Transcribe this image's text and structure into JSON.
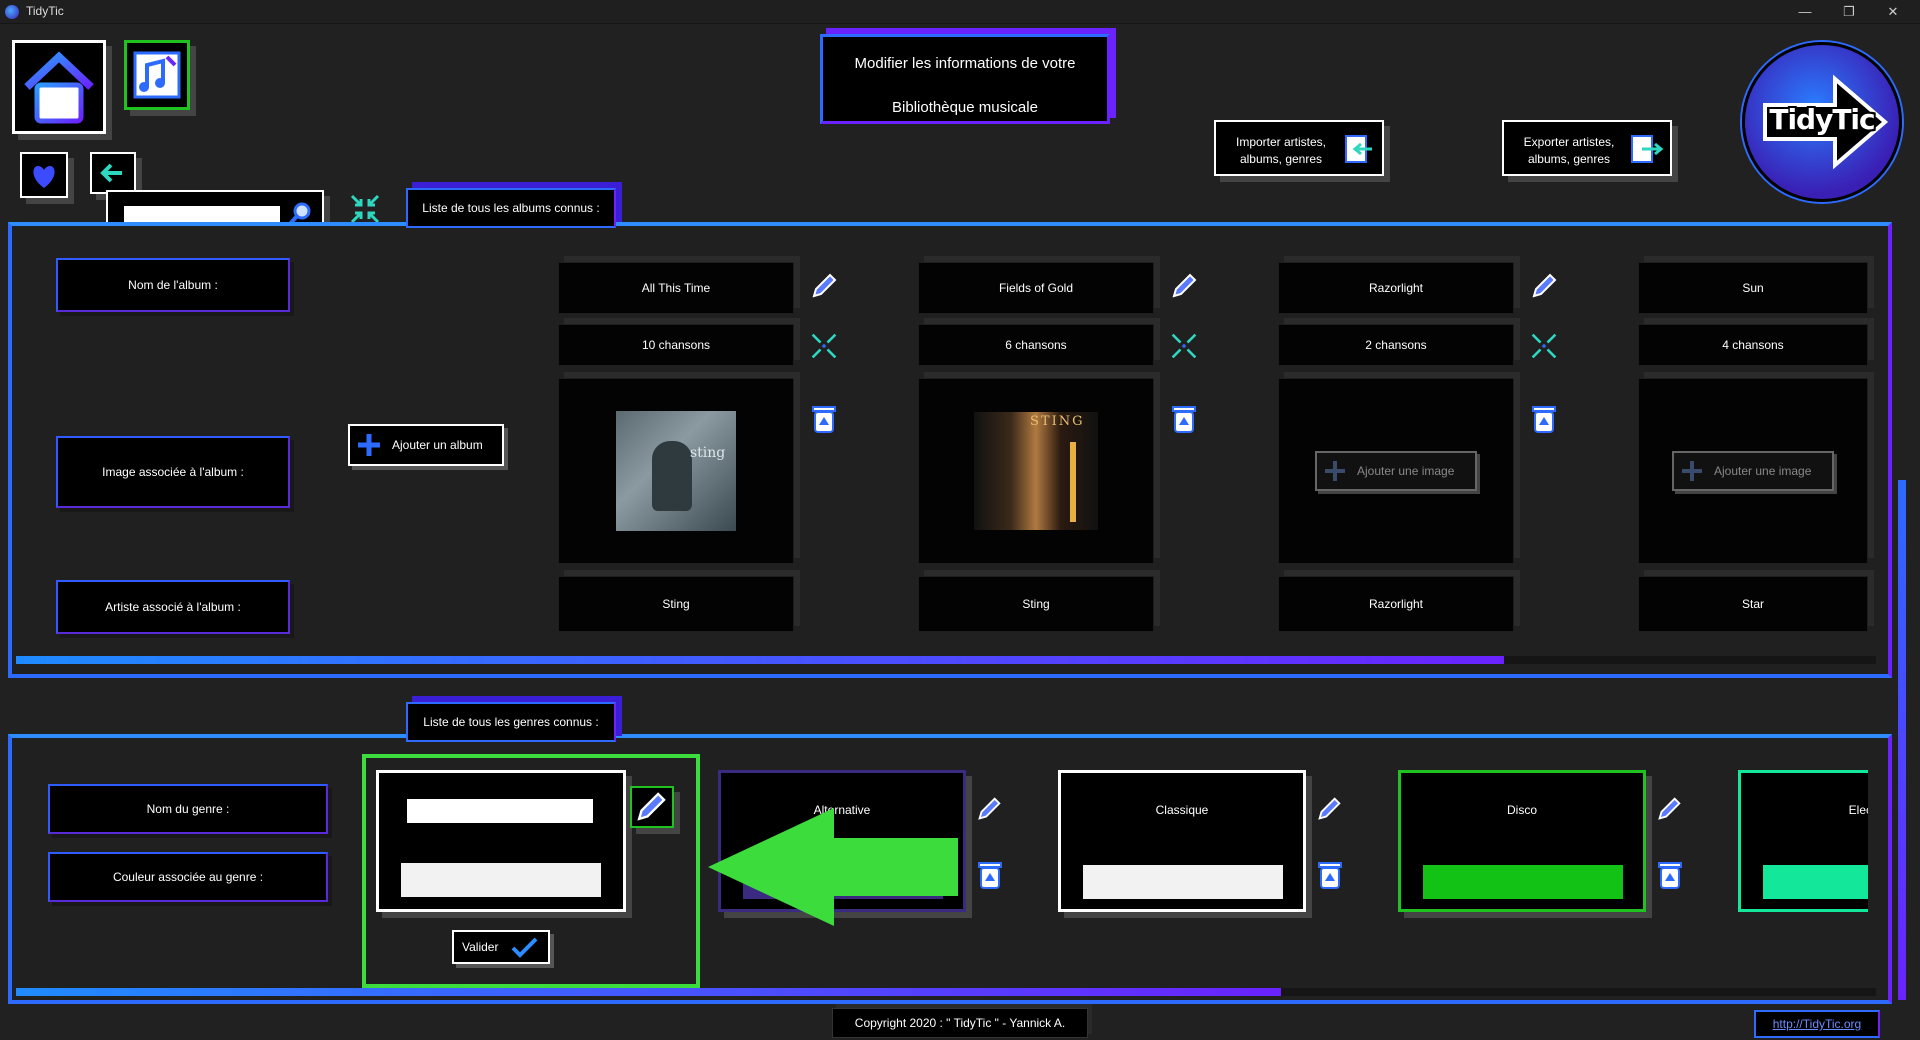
{
  "window": {
    "title": "TidyTic",
    "min": "—",
    "max": "❐",
    "close": "✕"
  },
  "header": {
    "line1": "Modifier les informations de votre",
    "line2": "Bibliothèque musicale"
  },
  "import_btn": {
    "line1": "Importer artistes,",
    "line2": "albums, genres"
  },
  "export_btn": {
    "line1": "Exporter artistes,",
    "line2": "albums, genres"
  },
  "logo": {
    "text": "TidyTic"
  },
  "search": {
    "value": "",
    "placeholder": ""
  },
  "albums": {
    "tab_label": "Liste de tous les albums connus :",
    "row_labels": {
      "name": "Nom de l'album :",
      "image": "Image associée à l'album :",
      "artist": "Artiste associé à l'album :"
    },
    "add_label": "Ajouter un album",
    "add_image_label": "Ajouter une image",
    "items": [
      {
        "name": "All This Time",
        "count": "10 chansons",
        "artist": "Sting",
        "has_image": true
      },
      {
        "name": "Fields of Gold",
        "count": "6 chansons",
        "artist": "Sting",
        "has_image": true
      },
      {
        "name": "Razorlight",
        "count": "2 chansons",
        "artist": "Razorlight",
        "has_image": false
      },
      {
        "name": "Sun",
        "count": "4 chansons",
        "artist": "Star",
        "has_image": false
      }
    ],
    "scroll_fraction": 0.8
  },
  "genres": {
    "tab_label": "Liste de tous les genres connus :",
    "row_labels": {
      "name": "Nom du genre :",
      "color": "Couleur associée au genre :"
    },
    "new_name_value": "",
    "validate_label": "Valider",
    "items": [
      {
        "name": "Alternative",
        "color": "#3a2a80",
        "border": "#3a2a80"
      },
      {
        "name": "Classique",
        "color": "#f2f2f2",
        "border": "#ffffff"
      },
      {
        "name": "Disco",
        "color": "#12c214",
        "border": "#1fc21f"
      },
      {
        "name": "Elect",
        "color": "#12e79a",
        "border": "#12e79a"
      }
    ],
    "scroll_fraction": 0.68
  },
  "footer": {
    "copyright": "Copyright 2020 : \" TidyTic \" - Yannick A.",
    "link": "http://TidyTic.org"
  },
  "colors": {
    "accent_blue": "#2d6bff",
    "accent_purple": "#6a23ff",
    "highlight_green": "#3ddc3d"
  }
}
